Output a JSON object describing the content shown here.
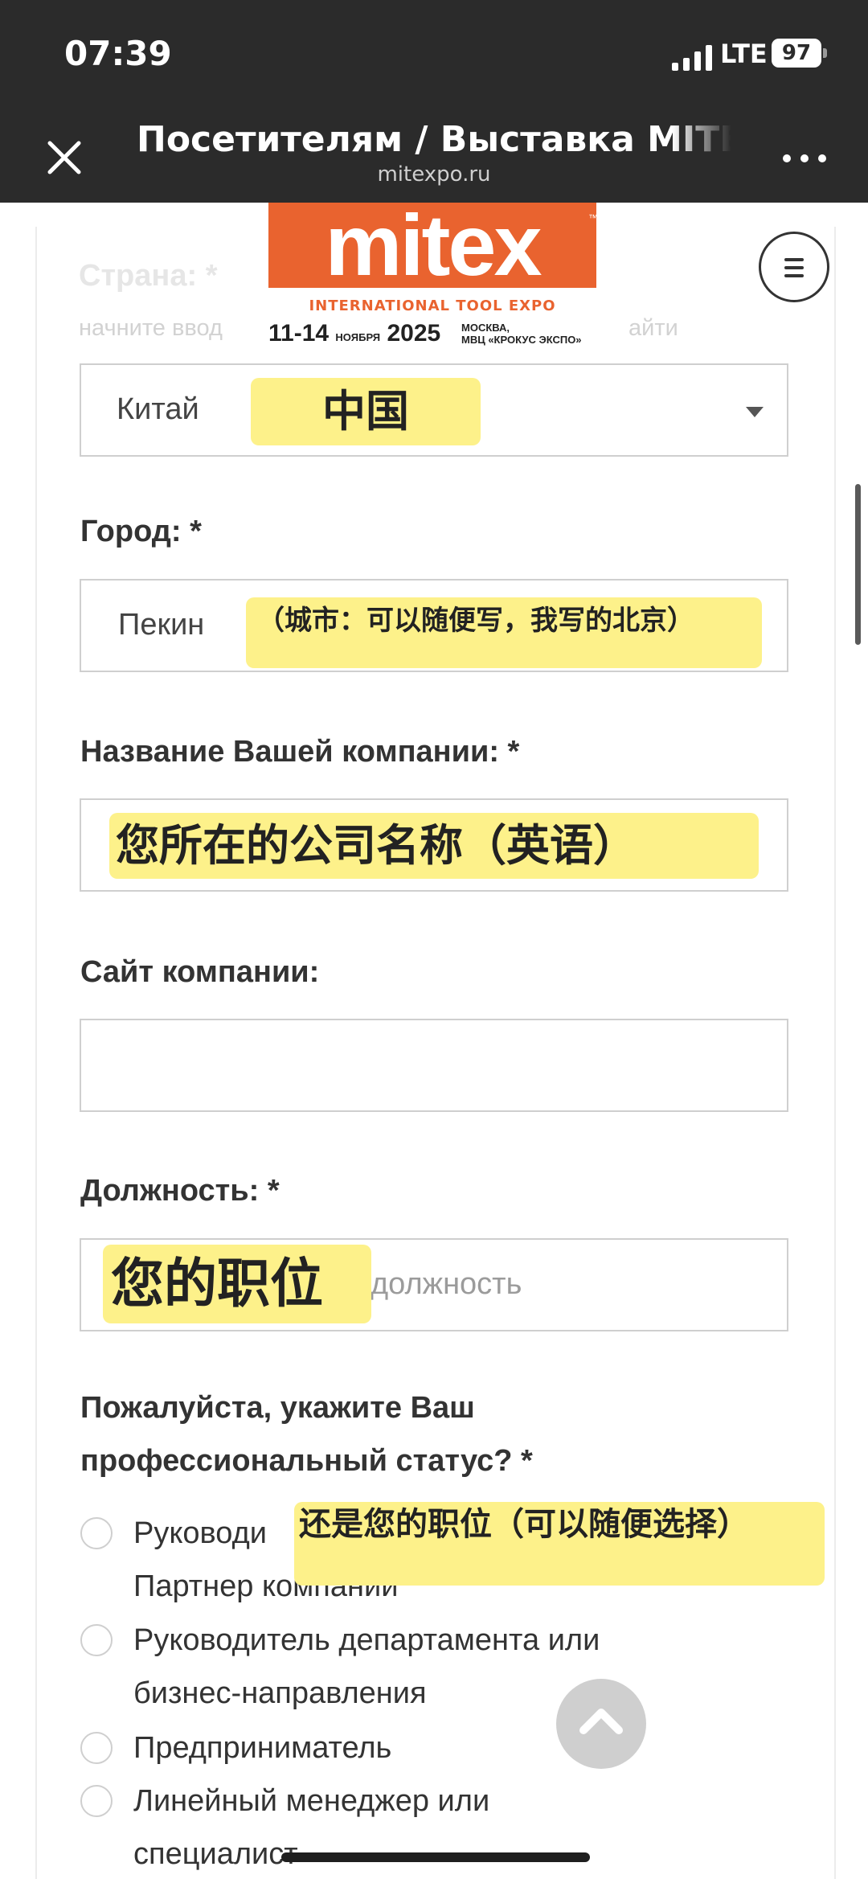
{
  "status_bar": {
    "time": "07:39",
    "network": "LTE",
    "battery": "97"
  },
  "nav": {
    "title": "Посетителям / Выставка MITEX",
    "url": "mitexpo.ru"
  },
  "logo": {
    "brand": "mitex",
    "tagline": "INTERNATIONAL TOOL EXPO",
    "dates": "11-14",
    "month": "НОЯБРЯ",
    "year": "2025",
    "venue_line1": "МОСКВА,",
    "venue_line2": "МВЦ «КРОКУС ЭКСПО»"
  },
  "form": {
    "country": {
      "label": "Страна: *",
      "hint_left": "начните ввод",
      "hint_right": "айти",
      "value": "Китай",
      "note": "中国"
    },
    "city": {
      "label": "Город: *",
      "value": "Пекин",
      "note": "（城市：可以随便写，我写的北京）"
    },
    "company": {
      "label": "Название Вашей компании: *",
      "note": "您所在的公司名称（英语）"
    },
    "website": {
      "label": "Сайт компании:"
    },
    "position": {
      "label": "Должность: *",
      "placeholder": "должность",
      "note": "您的职位"
    },
    "status": {
      "label_line1": "Пожалуйста, укажите Ваш",
      "label_line2": "профессиональный статус? *",
      "note": "还是您的职位（可以随便选择）",
      "options": [
        {
          "line1": "Руководи",
          "line2": "Партнер компании"
        },
        {
          "line1": "Руководитель департамента или",
          "line2": "бизнес-направления"
        },
        {
          "line1": "Предприниматель"
        },
        {
          "line1": "Линейный менеджер или",
          "line2": "специалист"
        }
      ]
    }
  },
  "colors": {
    "brand_orange": "#e9632f",
    "highlight_yellow": "#fdf18a",
    "dark_bar": "#2b2b2b"
  }
}
